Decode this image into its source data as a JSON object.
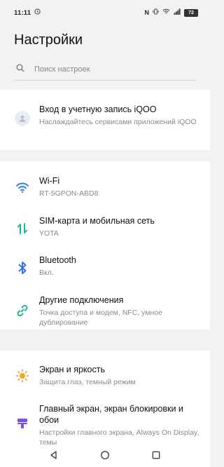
{
  "status_bar": {
    "time": "11:11",
    "battery": "72"
  },
  "page": {
    "title": "Настройки"
  },
  "search": {
    "placeholder": "Поиск настроек"
  },
  "account": {
    "title": "Вход в учетную запись iQOO",
    "subtitle": "Наслаждайтесь сервисами приложений iQOO"
  },
  "network": [
    {
      "title": "Wi-Fi",
      "subtitle": "RT-5GPON-ABD8",
      "icon": "wifi-icon"
    },
    {
      "title": "SIM-карта и мобильная сеть",
      "subtitle": "YOTA",
      "icon": "sim-arrows-icon"
    },
    {
      "title": "Bluetooth",
      "subtitle": "Вкл.",
      "icon": "bluetooth-icon"
    },
    {
      "title": "Другие подключения",
      "subtitle": "Точка доступа и модем, NFC, умное дублирование",
      "icon": "link-icon"
    }
  ],
  "display": [
    {
      "title": "Экран и яркость",
      "subtitle": "Защита глаз, темный режим",
      "icon": "sun-icon"
    },
    {
      "title": "Главный экран, экран блокировки и обои",
      "subtitle": "Настройки главного экрана, Always On Display, темы",
      "icon": "theme-icon"
    }
  ],
  "colors": {
    "wifi": "#2f7bf5",
    "sim": "#1fb59a",
    "bluetooth": "#3a6ff0",
    "link": "#1fb59a",
    "sun": "#f6a623",
    "theme": "#7b4cf0"
  }
}
